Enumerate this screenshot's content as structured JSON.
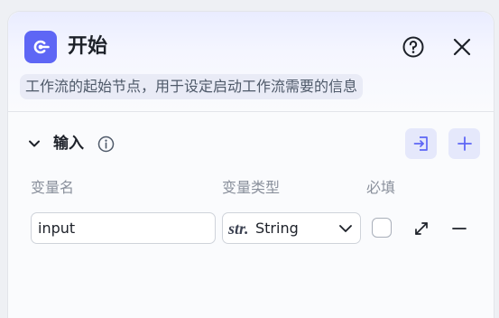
{
  "node": {
    "title": "开始",
    "description": "工作流的起始节点，用于设定启动工作流需要的信息",
    "icon": "start-node-icon",
    "accent_color": "#5e66f5"
  },
  "header_actions": {
    "help_icon": "help-circle-icon",
    "close_icon": "close-icon"
  },
  "input_section": {
    "title": "输入",
    "collapse_icon": "chevron-down-icon",
    "info_icon": "info-icon",
    "import_icon": "import-icon",
    "add_icon": "plus-icon",
    "columns": {
      "name": "变量名",
      "type": "变量类型",
      "required": "必填"
    },
    "rows": [
      {
        "name": "input",
        "type_tag": "str.",
        "type": "String",
        "required": false
      }
    ]
  }
}
